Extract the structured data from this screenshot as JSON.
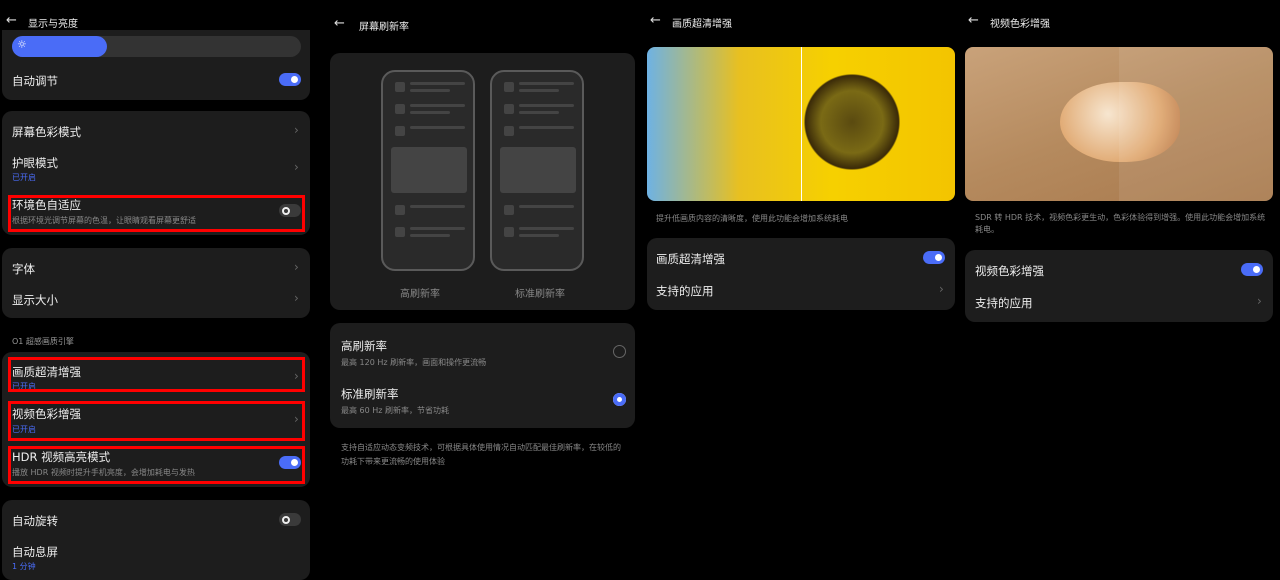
{
  "p1": {
    "title": "显示与亮度",
    "auto": "自动调节",
    "color_mode": "屏幕色彩模式",
    "eye": "护眼模式",
    "eye_status": "已开启",
    "ambient": "环境色自适应",
    "ambient_desc": "根据环境光调节屏幕的色温，让眼睛观看屏幕更舒适",
    "font": "字体",
    "size": "显示大小",
    "section": "O1 超感画质引擎",
    "sr": "画质超清增强",
    "sr_status": "已开启",
    "vc": "视频色彩增强",
    "vc_status": "已开启",
    "hdr": "HDR 视频高亮模式",
    "hdr_desc": "播放 HDR 视频时提升手机亮度，会增加耗电与发热",
    "rotate": "自动旋转",
    "sleep": "自动息屏",
    "sleep_value": "1 分钟",
    "brightness": 0.33
  },
  "p2": {
    "title": "屏幕刷新率",
    "high_label": "高刷新率",
    "std_label": "标准刷新率",
    "opt1": "高刷新率",
    "opt1_desc": "最高 120 Hz 刷新率，画面和操作更流畅",
    "opt2": "标准刷新率",
    "opt2_desc": "最高 60 Hz 刷新率，节省功耗",
    "footer": "支持自适应动态变频技术，可根据具体使用情况自动匹配最佳刷新率，在较低的功耗下带来更流畅的使用体验"
  },
  "p3": {
    "title": "画质超清增强",
    "desc": "提升低画质内容的清晰度，使用此功能会增加系统耗电",
    "toggle": "画质超清增强",
    "apps": "支持的应用"
  },
  "p4": {
    "title": "视频色彩增强",
    "desc": "SDR 转 HDR 技术，视频色彩更生动，色彩体验得到增强。使用此功能会增加系统耗电。",
    "toggle": "视频色彩增强",
    "apps": "支持的应用"
  },
  "colors": {
    "accent": "#4a6cf7",
    "highlight": "#ff0000"
  }
}
